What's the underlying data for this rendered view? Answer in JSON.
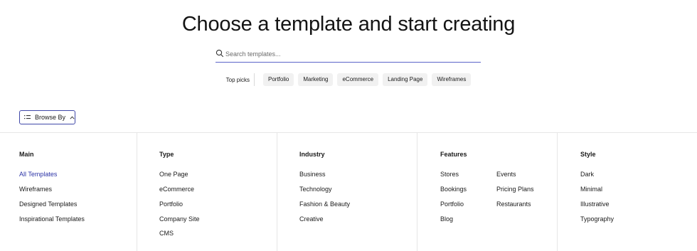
{
  "page": {
    "title": "Choose a template and start creating"
  },
  "search": {
    "placeholder": "Search templates..."
  },
  "top_picks": {
    "label": "Top picks",
    "chips": [
      "Portfolio",
      "Marketing",
      "eCommerce",
      "Landing Page",
      "Wireframes"
    ]
  },
  "browse": {
    "label": "Browse By"
  },
  "columns": [
    {
      "heading": "Main",
      "items": [
        "All Templates",
        "Wireframes",
        "Designed Templates",
        "Inspirational Templates"
      ],
      "active_index": 0
    },
    {
      "heading": "Type",
      "items": [
        "One Page",
        "eCommerce",
        "Portfolio",
        "Company Site",
        "CMS"
      ]
    },
    {
      "heading": "Industry",
      "items": [
        "Business",
        "Technology",
        "Fashion & Beauty",
        "Creative"
      ]
    },
    {
      "heading": "Features",
      "items": [
        "Stores",
        "Bookings",
        "Portfolio",
        "Blog"
      ],
      "items_b": [
        "Events",
        "Pricing Plans",
        "Restaurants"
      ]
    },
    {
      "heading": "Style",
      "items": [
        "Dark",
        "Minimal",
        "Illustrative",
        "Typography"
      ]
    }
  ],
  "colors": {
    "accent": "#2b33a6",
    "search_underline": "#5b64c9",
    "chip_bg": "#f1f1f1",
    "divider": "#e6e6e6"
  }
}
